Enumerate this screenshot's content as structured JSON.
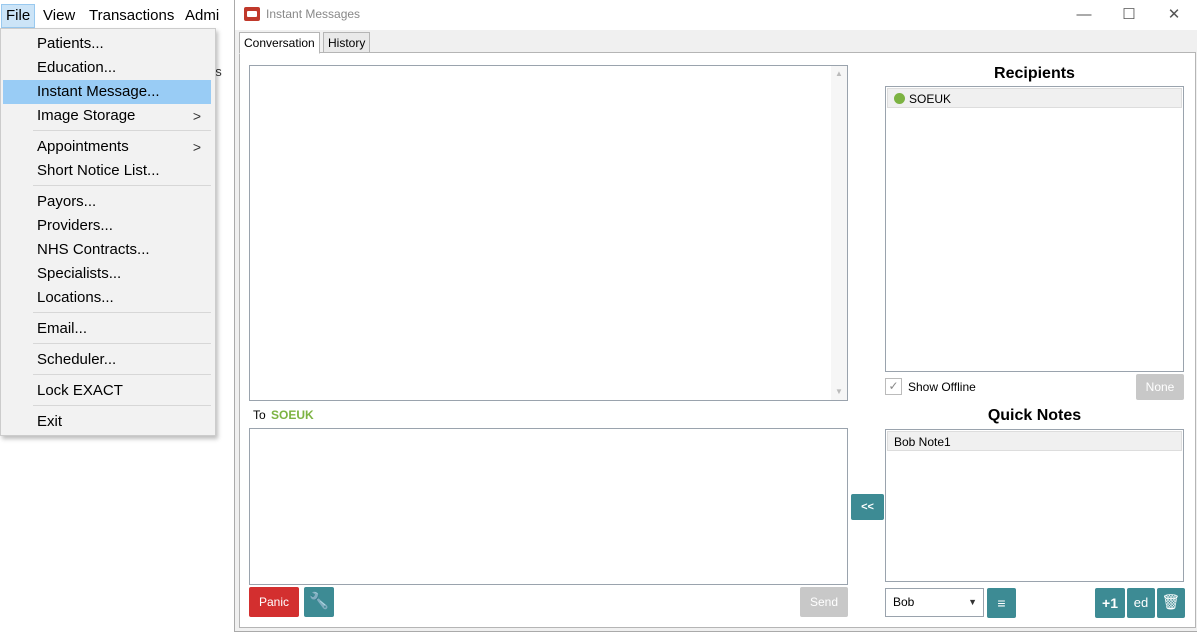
{
  "menubar": {
    "items": [
      "File",
      "View",
      "Transactions",
      "Admi"
    ],
    "behind_text": "es"
  },
  "file_menu": {
    "items": [
      {
        "label": "Patients...",
        "submenu": false
      },
      {
        "label": "Education...",
        "submenu": false
      },
      {
        "label": "Instant Message...",
        "submenu": false,
        "highlighted": true
      },
      {
        "label": "Image Storage",
        "submenu": true
      },
      {
        "label": "Appointments",
        "submenu": true
      },
      {
        "label": "Short Notice List...",
        "submenu": false
      },
      {
        "label": "Payors...",
        "submenu": false
      },
      {
        "label": "Providers...",
        "submenu": false
      },
      {
        "label": "NHS Contracts...",
        "submenu": false
      },
      {
        "label": "Specialists...",
        "submenu": false
      },
      {
        "label": "Locations...",
        "submenu": false
      },
      {
        "label": "Email...",
        "submenu": false
      },
      {
        "label": "Scheduler...",
        "submenu": false
      },
      {
        "label": "Lock EXACT",
        "submenu": false
      },
      {
        "label": "Exit",
        "submenu": false
      }
    ],
    "submenu_glyph": ">"
  },
  "window": {
    "title": "Instant Messages",
    "controls": {
      "minimize": "—",
      "maximize": "☐",
      "close": "✕"
    }
  },
  "tabs": [
    "Conversation",
    "History"
  ],
  "conversation": {
    "to_label": "To",
    "to_name": "SOEUK",
    "scroll_up": "▲",
    "scroll_down": "▼"
  },
  "buttons": {
    "panic": "Panic",
    "settings_icon": "🔧",
    "send": "Send",
    "insert": "<<",
    "none": "None",
    "notes_format_icon": "≡",
    "plus_one": "+1",
    "edit_note": "ed",
    "delete_note": "🗑"
  },
  "recipients": {
    "heading": "Recipients",
    "items": [
      {
        "name": "SOEUK",
        "status": "online",
        "status_color": "#7cb342"
      }
    ],
    "show_offline_label": "Show Offline",
    "show_offline_checked": true,
    "check_glyph": "✓"
  },
  "quick_notes": {
    "heading": "Quick Notes",
    "items": [
      "Bob Note1"
    ],
    "selected_user": "Bob",
    "dropdown_glyph": "▼"
  },
  "colors": {
    "accent": "#3d8b94",
    "panic": "#d32f2f",
    "online": "#7cb342",
    "menu_highlight": "#99ccf5"
  }
}
